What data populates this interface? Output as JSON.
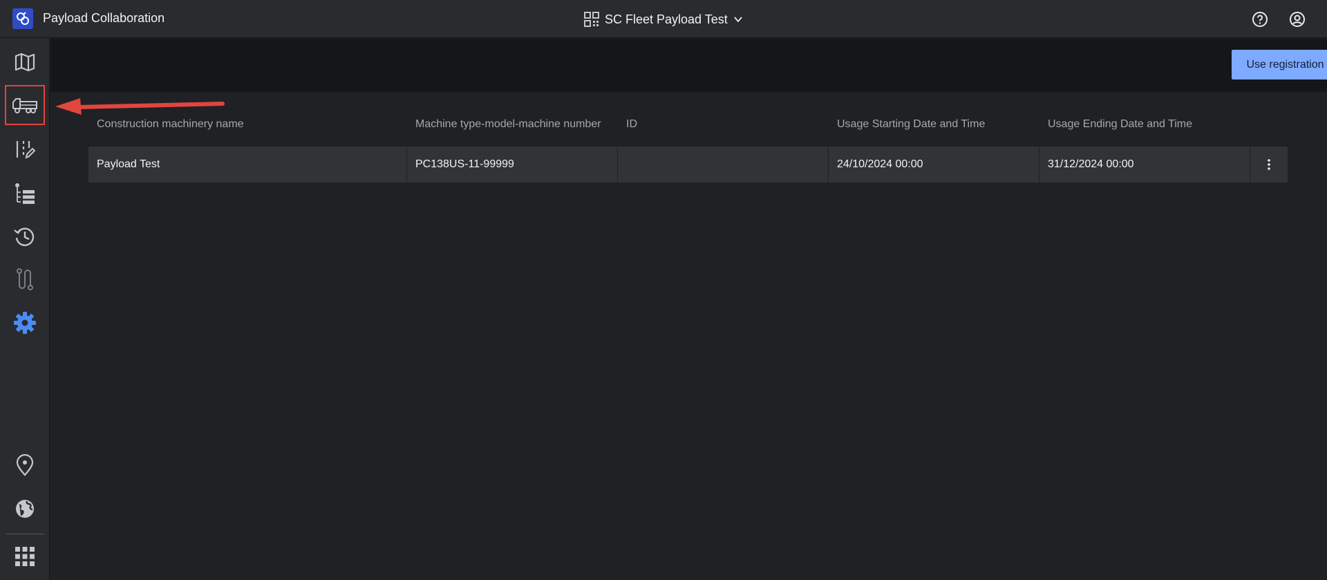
{
  "app": {
    "title": "Payload Collaboration"
  },
  "header": {
    "project_name": "SC Fleet Payload Test",
    "icons": [
      "qr-code-icon",
      "chevron-down-icon",
      "help-icon",
      "account-icon"
    ]
  },
  "sidebar": {
    "items": [
      {
        "name": "map",
        "icon": "map-icon"
      },
      {
        "name": "machinery",
        "icon": "truck-icon",
        "highlighted": true
      },
      {
        "name": "plan-edit",
        "icon": "plan-edit-icon"
      },
      {
        "name": "list",
        "icon": "list-icon"
      },
      {
        "name": "history",
        "icon": "history-icon"
      },
      {
        "name": "route",
        "icon": "route-icon"
      },
      {
        "name": "settings",
        "icon": "gear-icon",
        "active": true
      },
      {
        "name": "location",
        "icon": "location-pin-icon"
      },
      {
        "name": "globe",
        "icon": "globe-icon"
      },
      {
        "name": "apps",
        "icon": "grid-icon"
      }
    ]
  },
  "toolbar": {
    "use_registration_label": "Use registration"
  },
  "table": {
    "headers": [
      "Construction machinery name",
      "Machine type-model-machine number",
      "ID",
      "Usage Starting Date and Time",
      "Usage Ending Date and Time"
    ],
    "rows": [
      {
        "name": "Payload Test",
        "model": "PC138US-11-99999",
        "id": "",
        "start": "24/10/2024 00:00",
        "end": "31/12/2024 00:00"
      }
    ]
  },
  "colors": {
    "accent": "#7eaaff",
    "active_icon": "#4a8cf7",
    "annotation": "#e3453f",
    "logo": "#2f4cc7"
  }
}
